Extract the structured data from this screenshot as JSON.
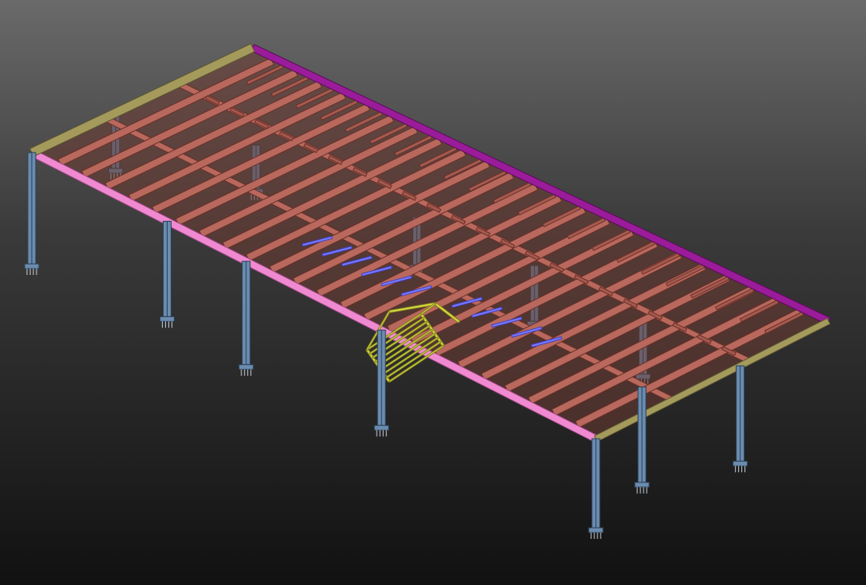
{
  "viewport": {
    "background_top": "#6a6a6a",
    "background_bottom": "#111111"
  },
  "model": {
    "type": "isometric steel mezzanine frame",
    "colors": {
      "beam": "#b8685c",
      "beam_edge": "#6a3028",
      "edge_beam_front": "#f08ad0",
      "edge_beam_back": "#9a1c9a",
      "edge_beam_side": "#a49a5c",
      "column": "#6a8cb0",
      "column_edge": "#2c3e52",
      "joist": "#7a7aff",
      "stair": "#dada40"
    }
  }
}
